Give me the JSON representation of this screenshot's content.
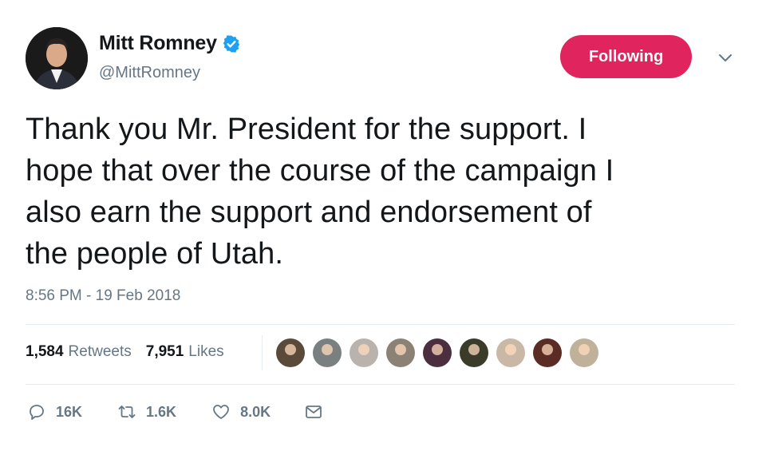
{
  "user": {
    "display_name": "Mitt Romney",
    "handle": "@MittRomney",
    "verified_icon": "verified-badge-icon"
  },
  "follow_button": {
    "label": "Following",
    "color": "#e0245e"
  },
  "tweet": {
    "lines": [
      "Thank you Mr. President for the support. I",
      "hope that over the course of the campaign I",
      "also earn the support and endorsement of",
      "the people of Utah."
    ],
    "timestamp": "8:56 PM - 19 Feb 2018"
  },
  "stats": {
    "retweets_count": "1,584",
    "retweets_label": "Retweets",
    "likes_count": "7,951",
    "likes_label": "Likes"
  },
  "likers": [
    {
      "color": "#5a4a3a"
    },
    {
      "color": "#7a7f80"
    },
    {
      "color": "#b9b2ad"
    },
    {
      "color": "#8c8175"
    },
    {
      "color": "#4b2f3f"
    },
    {
      "color": "#3b3b2a"
    },
    {
      "color": "#c9b8a6"
    },
    {
      "color": "#5b2c24"
    },
    {
      "color": "#bfb19a"
    }
  ],
  "actions": {
    "reply_count": "16K",
    "retweet_count": "1.6K",
    "like_count": "8.0K"
  },
  "colors": {
    "text": "#14171a",
    "muted": "#657786",
    "verified": "#1da1f2"
  }
}
